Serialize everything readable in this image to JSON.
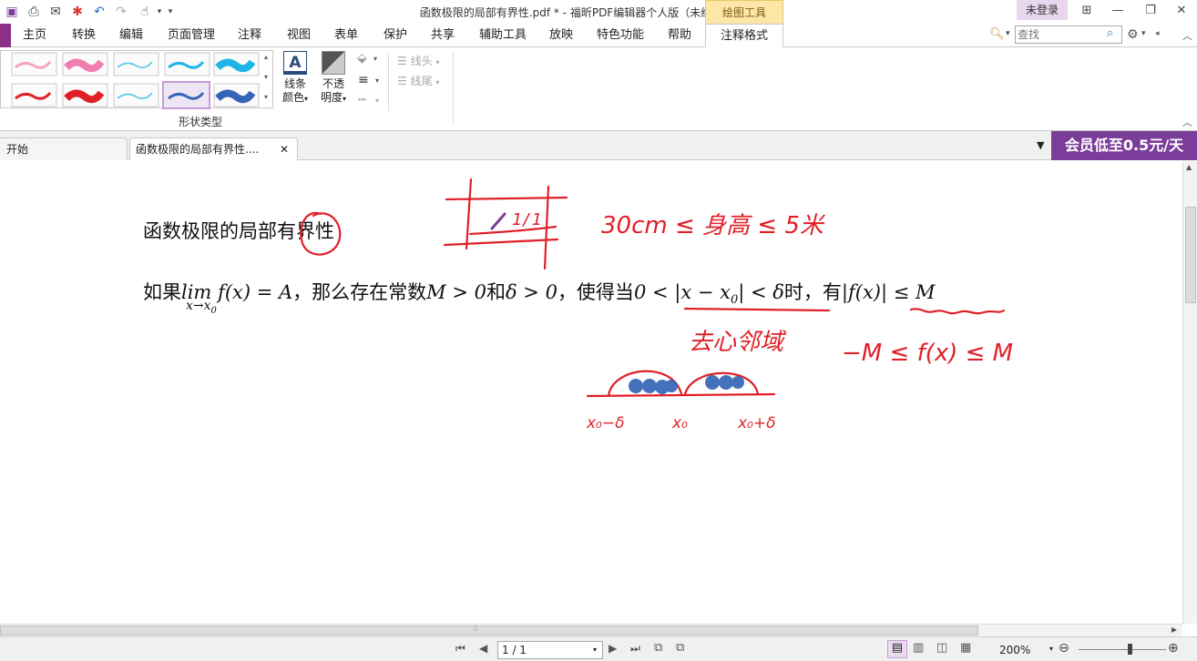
{
  "window": {
    "title": "函数极限的局部有界性.pdf * - 福昕PDF编辑器个人版（未经授权的产品）",
    "context_tab": "绘图工具",
    "login": "未登录"
  },
  "menu": {
    "tabs": [
      "主页",
      "转换",
      "编辑",
      "页面管理",
      "注释",
      "视图",
      "表单",
      "保护",
      "共享",
      "辅助工具",
      "放映",
      "特色功能",
      "帮助",
      "注释格式"
    ],
    "active_tab": "注释格式"
  },
  "search": {
    "placeholder": "查找"
  },
  "ribbon": {
    "gallery_label": "形状类型",
    "line_color": {
      "line1": "线条",
      "line2": "颜色"
    },
    "opacity": {
      "line1": "不透",
      "line2": "明度"
    },
    "line_head": "线头",
    "line_tail": "线尾",
    "swatch_colors": [
      "#f3a6c3",
      "#f07fb0",
      "#4ec6e8",
      "#1fb4e6",
      "#e02028",
      "#e02028",
      "#4ec6e8",
      "#3565b6",
      "#3565b6"
    ]
  },
  "doc_tabs": {
    "start": "开始",
    "current": "函数极限的局部有界性....",
    "promo": "会员低至0.5元/天"
  },
  "document": {
    "heading": "函数极限的局部有界性",
    "theorem_prefix": "如果",
    "lim": "lim",
    "lim_sub": "x→x",
    "lim_sub_index": "0",
    "f_eq": "f(x) = A",
    "part2": "，那么存在常数",
    "m_gt": "M > 0",
    "and": "和",
    "delta_gt": "δ > 0",
    "part3": "，使得当",
    "interval": "0 < |x − x",
    "interval_sub": "0",
    "interval_end": "| < δ",
    "part4": "时，有",
    "bound": "|f(x)| ≤ M"
  },
  "annotations": {
    "pen_color": "#e02028",
    "dot_color": "#3565b6",
    "note1": "30cm ≤ 身高 ≤ 5米",
    "note2": "去心邻域",
    "note3": "−M ≤ f(x) ≤ M",
    "label_left": "x₀−δ",
    "label_mid": "x₀",
    "label_right": "x₀+δ",
    "box_text": "1/1"
  },
  "status": {
    "page": "1 / 1",
    "zoom": "200%"
  }
}
